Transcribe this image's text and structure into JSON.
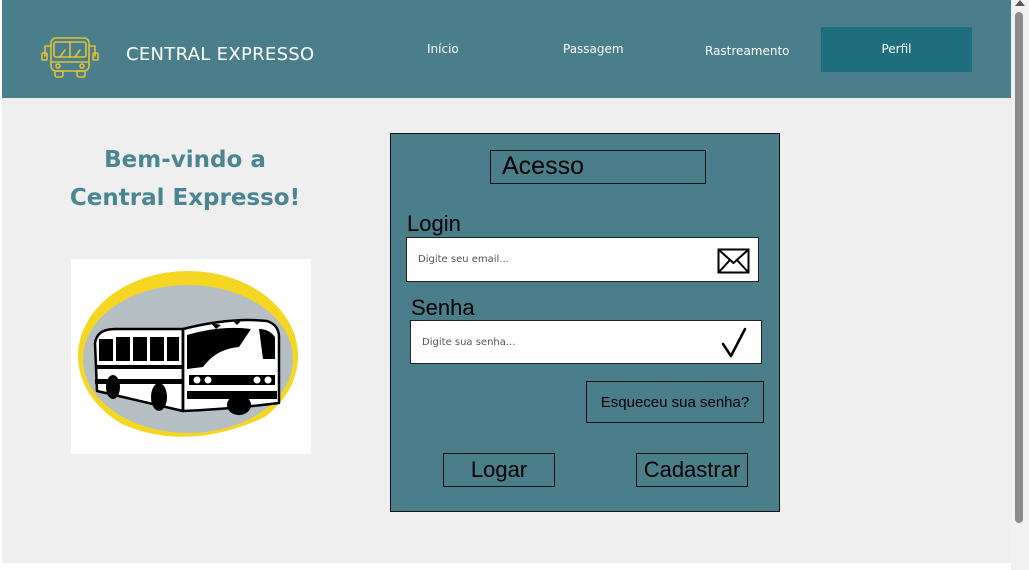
{
  "header": {
    "brand_name": "CENTRAL EXPRESSO",
    "nav": [
      "Início",
      "Passagem",
      "Rastreamento"
    ],
    "profile_button": "Perfil"
  },
  "welcome": {
    "line1": "Bem-vindo a",
    "line2": "Central Expresso!"
  },
  "login_form": {
    "title": "Acesso",
    "login_label": "Login",
    "login_placeholder": "Digite seu email...",
    "password_label": "Senha",
    "password_placeholder": "Digite sua senha...",
    "forgot_password": "Esqueceu sua senha?",
    "login_button": "Logar",
    "register_button": "Cadastrar"
  },
  "colors": {
    "header_bg": "#497e8a",
    "profile_bg": "#1d6f7e",
    "page_bg": "#efefef",
    "welcome_text": "#4a8594",
    "panel_bg": "#497e8a",
    "bus_yellow": "#f5d623"
  },
  "icons": {
    "brand": "bus-icon",
    "login_field": "envelope-icon",
    "password_field": "checkmark-icon",
    "illustration": "bus-illustration"
  }
}
